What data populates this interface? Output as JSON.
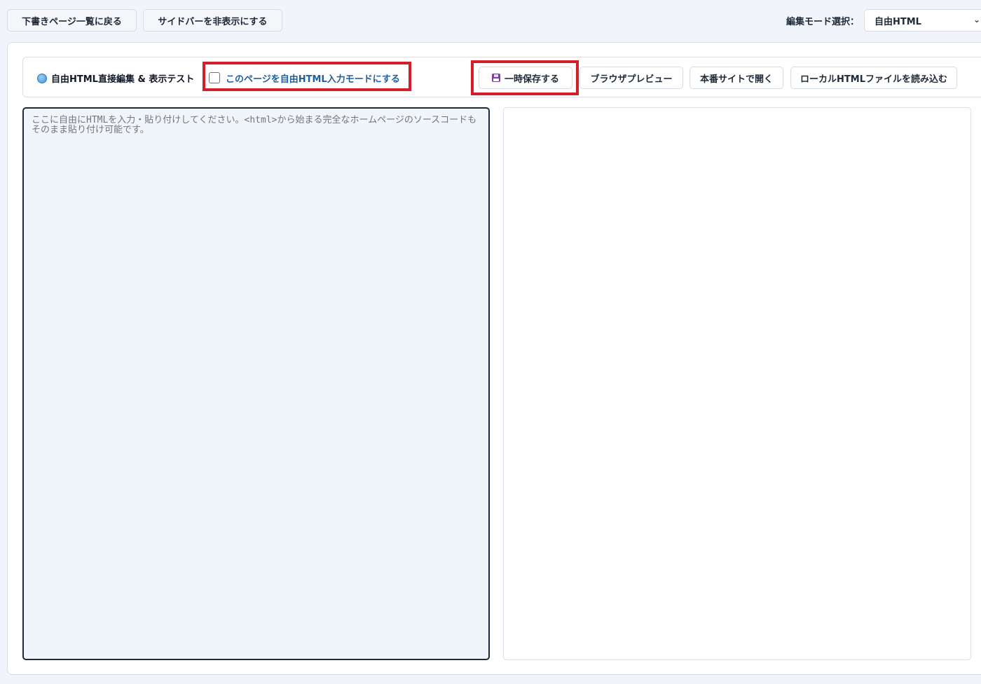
{
  "topbar": {
    "back_label": "下書きページ一覧に戻る",
    "sidebar_label": "サイドバーを非表示にする",
    "mode_label": "編集モード選択：",
    "mode_value": "自由HTML"
  },
  "toolbar": {
    "title": "自由HTML直接編集 & 表示テスト",
    "title_icon": "globe-icon",
    "checkbox_label": "このページを自由HTML入力モードにする",
    "checkbox_checked": false,
    "save_label": "一時保存する",
    "save_icon": "floppy-disk-icon",
    "preview_label": "ブラウザプレビュー",
    "open_label": "本番サイトで開く",
    "load_label": "ローカルHTMLファイルを読み込む"
  },
  "editor": {
    "placeholder": "ここに自由にHTMLを入力・貼り付けしてください。<html>から始まる完全なホームページのソースコードもそのまま貼り付け可能です。",
    "value": ""
  },
  "highlight_color": "#d21f2a"
}
